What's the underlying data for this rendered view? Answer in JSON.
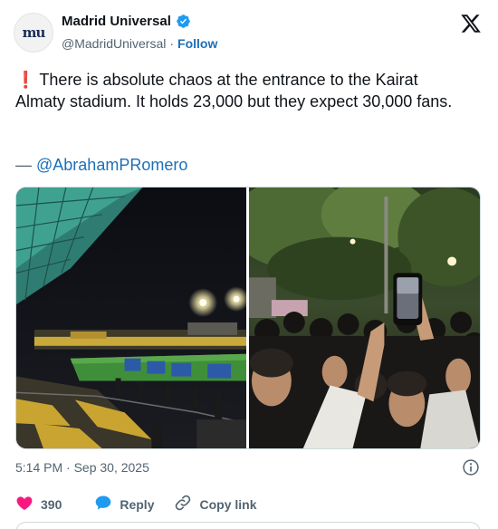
{
  "account": {
    "name": "Madrid Universal",
    "handle": "@MadridUniversal",
    "separator": "·",
    "follow": "Follow",
    "avatar_logo": "mu"
  },
  "tweet": {
    "emoji": "❗",
    "text": "There is absolute chaos at the entrance to the Kairat Almaty stadium. It holds 23,000 but they expect 30,000 fans.",
    "credit_dash": "—",
    "credit_handle": "@AbrahamPRomero"
  },
  "media": {
    "images": [
      "stadium-night-photo",
      "crowd-entrance-photo"
    ]
  },
  "meta": {
    "timestamp": "5:14 PM · Sep 30, 2025"
  },
  "actions": {
    "likes": "390",
    "reply": "Reply",
    "copy_link": "Copy link"
  },
  "colors": {
    "accent": "#1d6fb8",
    "like": "#f91880",
    "verified": "#1d9bf0",
    "muted": "#536471"
  },
  "icons": {
    "verified": "verified-badge-icon",
    "brand": "x-logo-icon",
    "info": "info-icon",
    "like": "heart-icon",
    "reply": "speech-bubble-icon",
    "copy": "link-icon"
  }
}
